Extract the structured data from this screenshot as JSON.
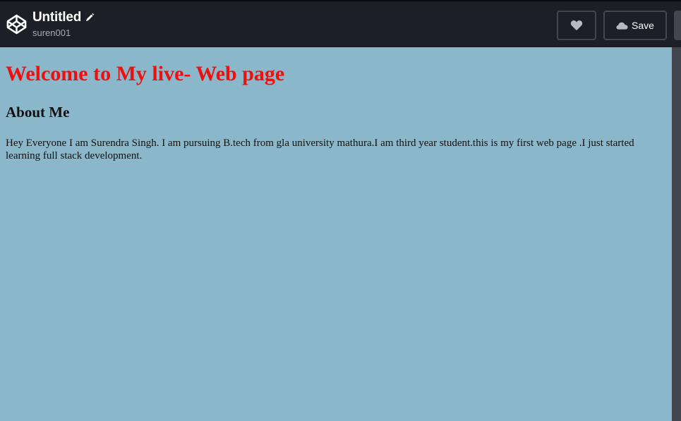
{
  "header": {
    "title": "Untitled",
    "username": "suren001",
    "save_label": "Save"
  },
  "icons": {
    "logo": "codepen-logo-icon",
    "edit": "pencil-icon",
    "like": "heart-icon",
    "save": "cloud-icon"
  },
  "preview": {
    "heading": "Welcome to My live- Web page",
    "subheading": "About Me",
    "paragraph": "Hey Everyone I am Surendra Singh. I am pursuing B.tech from gla university mathura.I am third year student.this is my first web page .I just started learning full stack development."
  },
  "colors": {
    "toolbar_bg": "#1e1f26",
    "preview_bg": "#8ab7c9",
    "heading_color": "#ee0f0f"
  }
}
